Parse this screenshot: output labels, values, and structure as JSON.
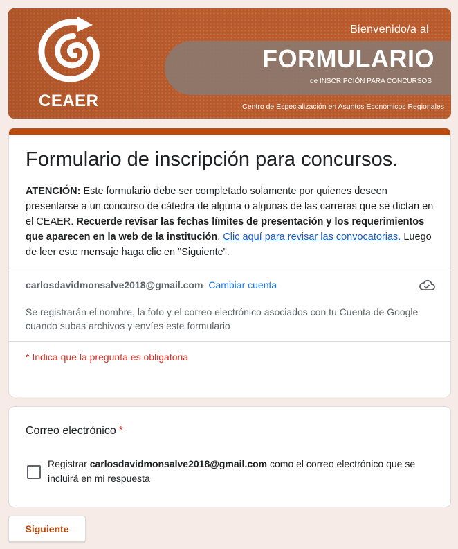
{
  "banner": {
    "logo_text": "CEAER",
    "welcome": "Bienvenido/a al",
    "form_word": "FORMULARIO",
    "subtitle": "de INSCRIPCIÓN PARA CONCURSOS",
    "center_name": "Centro de Especialización en Asuntos Económicos Regionales"
  },
  "form": {
    "title": "Formulario de inscripción para concursos.",
    "desc": {
      "p1_bold": "ATENCIÓN:",
      "p1_text": " Este formulario debe ser completado solamente por quienes deseen presentarse a un concurso de cátedra de alguna o algunas de las carreras que se dictan en el CEAER. ",
      "p2_bold": "Recuerde revisar las fechas límites de presentación y los requerimientos que aparecen en la web de la institución",
      "p2_dot": ". ",
      "link": "Clic aquí para revisar las convocatorias.",
      "p3_text": " Luego de leer este mensaje haga clic en \"Siguiente\"."
    },
    "account_email": "carlosdavidmonsalve2018@gmail.com",
    "switch_account": "Cambiar cuenta",
    "notice": "Se registrarán el nombre, la foto y el correo electrónico asociados con tu Cuenta de Google cuando subas archivos y envíes este formulario",
    "required_note": "* Indica que la pregunta es obligatoria"
  },
  "question": {
    "title": "Correo electrónico",
    "required_mark": "*",
    "cb_prefix": "Registrar ",
    "cb_email": "carlosdavidmonsalve2018@gmail.com",
    "cb_suffix": " como el correo electrónico que se incluirá en mi respuesta",
    "checked": false
  },
  "actions": {
    "next_label": "Siguiente"
  },
  "colors": {
    "accent": "#bb4b0e",
    "banner": "#b85a2b",
    "link": "#1a73e8",
    "required": "#d93025"
  },
  "icons": {
    "logo": "spiral-logo-icon",
    "cloud": "cloud-check-icon"
  }
}
